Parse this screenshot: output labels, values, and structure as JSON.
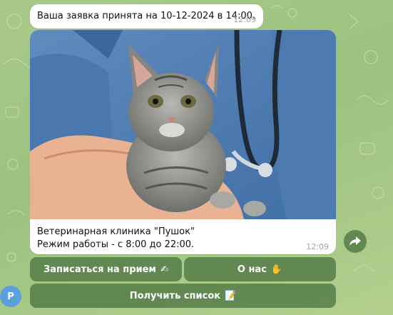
{
  "messages": [
    {
      "text": "Ваша заявка принята на 10-12-2024 в 14:00.",
      "time": "12:09"
    },
    {
      "caption_line1": "Ветеринарная клиника \"Пушок\"",
      "caption_line2": "Режим работы - с 8:00 до 22:00.",
      "time": "12:09"
    }
  ],
  "keyboard": {
    "book_label": "Записаться на прием",
    "book_emoji": "✍",
    "about_label": "О нас",
    "about_emoji": "✋",
    "list_label": "Получить список",
    "list_emoji": "📝"
  },
  "avatar": {
    "letter": "P",
    "color": "#5aa0de"
  },
  "icons": {
    "share": "share-icon"
  }
}
